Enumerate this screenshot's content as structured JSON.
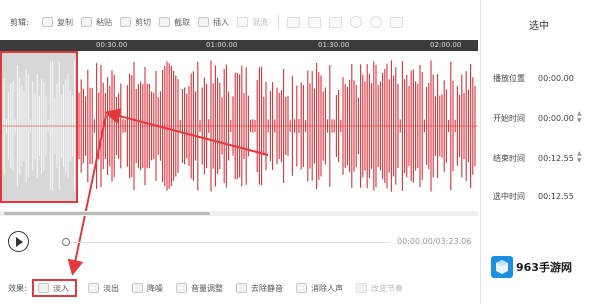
{
  "toolbar": {
    "label": "剪辑:",
    "tools": [
      {
        "label": "复制",
        "icon": "copy-icon",
        "enabled": true
      },
      {
        "label": "粘贴",
        "icon": "paste-icon",
        "enabled": true
      },
      {
        "label": "剪切",
        "icon": "cut-icon",
        "enabled": true
      },
      {
        "label": "截取",
        "icon": "crop-icon",
        "enabled": true
      },
      {
        "label": "插入",
        "icon": "insert-icon",
        "enabled": true
      },
      {
        "label": "混流",
        "icon": "mix-icon",
        "enabled": false
      }
    ],
    "mini_icons": [
      "undo-icon",
      "redo-icon",
      "delete-icon",
      "zoom-in-icon",
      "zoom-out-icon",
      "fit-icon"
    ]
  },
  "timeline": {
    "ticks": [
      "00:30.00",
      "01:00.00",
      "01:30.00",
      "02:00.00"
    ]
  },
  "panel": {
    "title": "选中",
    "rows": [
      {
        "key": "播放位置",
        "value": "00:00.00"
      },
      {
        "key": "开始时间",
        "value": "00:00.00"
      },
      {
        "key": "结束时间",
        "value": "00:12.55"
      },
      {
        "key": "选中时间",
        "value": "00:12.55"
      }
    ]
  },
  "transport": {
    "time_readout": "00:00.00/03:23.06"
  },
  "effects": {
    "label": "效果:",
    "items": [
      {
        "label": "淡入",
        "icon": "fade-in-icon",
        "highlighted": true
      },
      {
        "label": "淡出",
        "icon": "fade-out-icon"
      },
      {
        "label": "降噪",
        "icon": "denoise-icon"
      },
      {
        "label": "音量调整",
        "icon": "volume-adjust-icon"
      },
      {
        "label": "去除静音",
        "icon": "remove-silence-icon"
      },
      {
        "label": "消除人声",
        "icon": "remove-vocal-icon"
      },
      {
        "label": "改变节奏",
        "icon": "tempo-icon",
        "enabled": false
      }
    ]
  },
  "watermark": {
    "text": "963手游网"
  },
  "colors": {
    "accent": "#e4393c",
    "waveform": "#d9262e",
    "timeline_bg": "#3c3c3c",
    "selection_bg": "#d7d7d7",
    "watermark_blue": "#1d8fe1"
  }
}
